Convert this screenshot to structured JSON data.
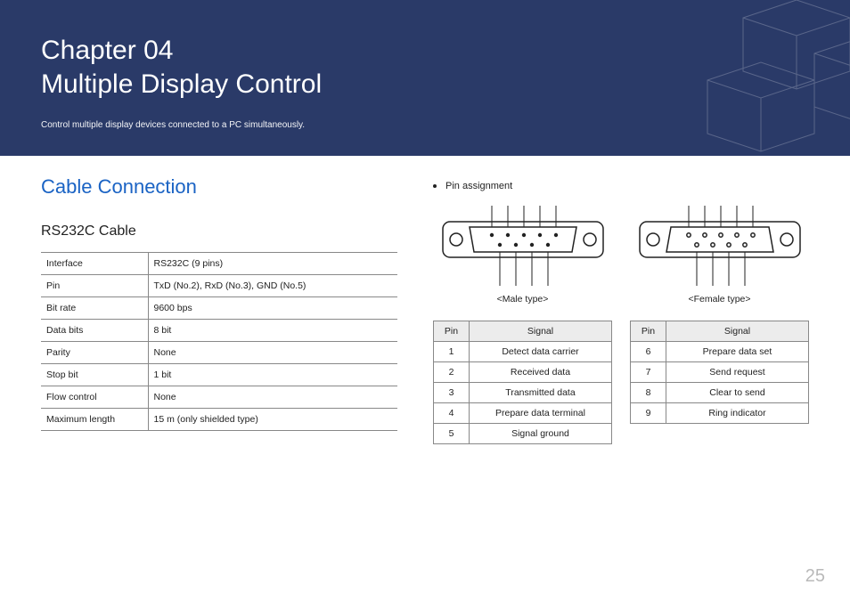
{
  "banner": {
    "chapter": "Chapter  04",
    "title": "Multiple Display Control",
    "subtitle": "Control multiple display devices connected to a PC simultaneously."
  },
  "section_heading": "Cable Connection",
  "cable_heading": "RS232C Cable",
  "spec_rows": [
    {
      "k": "Interface",
      "v": "RS232C (9 pins)"
    },
    {
      "k": "Pin",
      "v": "TxD (No.2), RxD (No.3), GND (No.5)"
    },
    {
      "k": "Bit rate",
      "v": "9600 bps"
    },
    {
      "k": "Data bits",
      "v": "8 bit"
    },
    {
      "k": "Parity",
      "v": "None"
    },
    {
      "k": "Stop bit",
      "v": "1 bit"
    },
    {
      "k": "Flow control",
      "v": "None"
    },
    {
      "k": "Maximum length",
      "v": "15 m (only shielded type)"
    }
  ],
  "pin_assign_label": "Pin assignment",
  "male_label": "<Male type>",
  "female_label": "<Female type>",
  "pin_headers": {
    "pin": "Pin",
    "signal": "Signal"
  },
  "pins_left": [
    {
      "pin": "1",
      "signal": "Detect data carrier"
    },
    {
      "pin": "2",
      "signal": "Received data"
    },
    {
      "pin": "3",
      "signal": "Transmitted data"
    },
    {
      "pin": "4",
      "signal": "Prepare data terminal"
    },
    {
      "pin": "5",
      "signal": "Signal ground"
    }
  ],
  "pins_right": [
    {
      "pin": "6",
      "signal": "Prepare data set"
    },
    {
      "pin": "7",
      "signal": "Send request"
    },
    {
      "pin": "8",
      "signal": "Clear to send"
    },
    {
      "pin": "9",
      "signal": "Ring indicator"
    }
  ],
  "page_number": "25"
}
